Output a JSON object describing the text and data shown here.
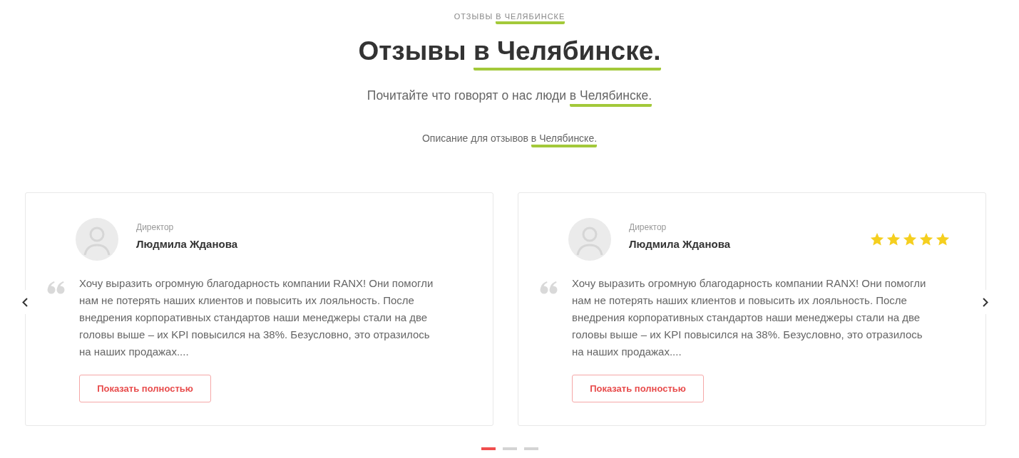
{
  "header": {
    "eyebrow": {
      "text": "ОТЗЫВЫ ",
      "highlight": "В ЧЕЛЯБИНСКЕ"
    },
    "title": {
      "text": "Отзывы ",
      "highlight": "в Челябинске."
    },
    "subtitle": {
      "text": "Почитайте что говорят о нас люди ",
      "highlight": "в Челябинске."
    },
    "description": {
      "text": "Описание для отзывов ",
      "highlight": "в Челябинске."
    }
  },
  "reviews": [
    {
      "role": "Директор",
      "name": "Людмила Жданова",
      "text": "Хочу выразить огромную благодарность компании RANX! Они помогли нам не потерять наших клиентов и повысить их лояльность. После внедрения корпоративных стандартов наши менеджеры стали на две головы выше – их KPI повысился на 38%. Безусловно, это отразилось на наших продажах....",
      "button": "Показать полностью"
    },
    {
      "role": "Директор",
      "name": "Людмила Жданова",
      "stars": 5,
      "text": "Хочу выразить огромную благодарность компании RANX! Они помогли нам не потерять наших клиентов и повысить их лояльность. После внедрения корпоративных стандартов наши менеджеры стали на две головы выше – их KPI повысился на 38%. Безусловно, это отразилось на наших продажах....",
      "button": "Показать полностью"
    }
  ],
  "pagination": [
    {
      "selected": true
    },
    {
      "selected": false
    },
    {
      "selected": false
    }
  ]
}
